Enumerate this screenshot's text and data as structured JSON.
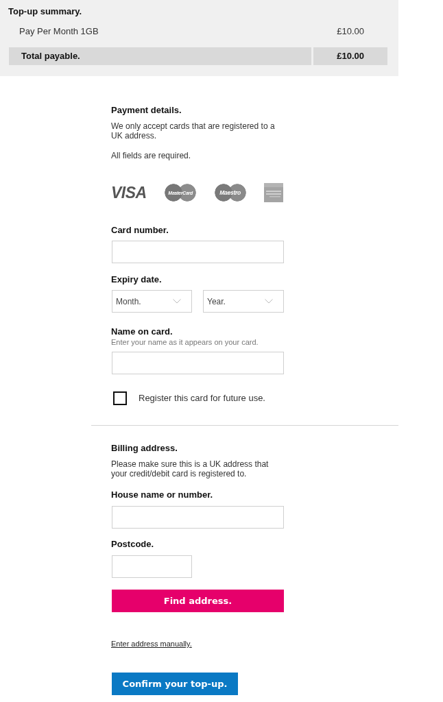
{
  "summary": {
    "title": "Top-up summary.",
    "items": [
      {
        "name": "Pay Per Month 1GB",
        "price": "£10.00"
      }
    ],
    "total": {
      "label": "Total payable.",
      "amount": "£10.00"
    }
  },
  "payment": {
    "title": "Payment details.",
    "notes": [
      "We only accept cards that are registered to a UK address.",
      "All fields are required."
    ],
    "card_logos": [
      {
        "kind": "visa",
        "text": "VISA"
      },
      {
        "kind": "mastercard",
        "text": "MasterCard"
      },
      {
        "kind": "maestro",
        "text": "Maestro"
      },
      {
        "kind": "amex"
      }
    ],
    "fields": [
      {
        "kind": "text",
        "label": "Card number."
      },
      {
        "kind": "selects",
        "label": "Expiry date.",
        "selects": [
          {
            "placeholder": "Month."
          },
          {
            "placeholder": "Year."
          }
        ]
      },
      {
        "kind": "text",
        "label": "Name on card.",
        "hint": "Enter your name as it appears on your card."
      }
    ],
    "register_card": {
      "label": "Register this card for future use.",
      "checked": false
    }
  },
  "billing": {
    "title": "Billing address.",
    "notes": [
      "Please make sure this is a UK address that your credit/debit card is registered to."
    ],
    "fields": [
      {
        "kind": "text",
        "label": "House name or number."
      },
      {
        "kind": "short",
        "label": "Postcode."
      }
    ],
    "find_button": "Find address.",
    "manual_link": "Enter address manually."
  },
  "confirm_button": "Confirm your top-up."
}
